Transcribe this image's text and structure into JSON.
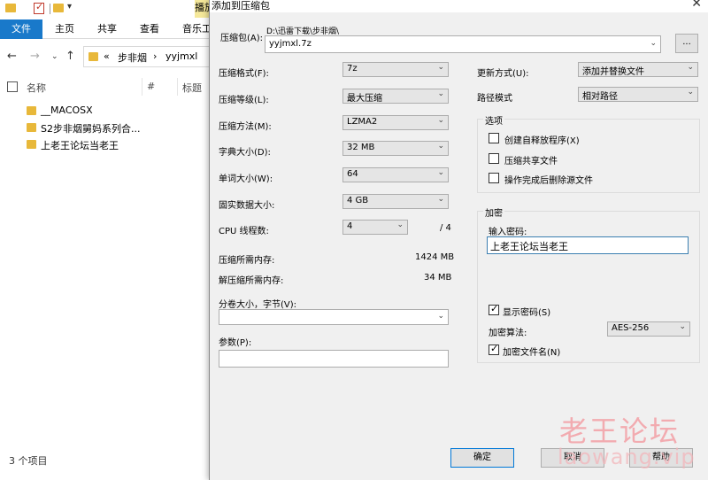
{
  "explorer": {
    "play_tab": "播放",
    "ribbon": {
      "file": "文件",
      "home": "主页",
      "share": "共享",
      "view": "查看",
      "music": "音乐工"
    },
    "breadcrumb": {
      "chevrons": "«",
      "crumb1": "步非烟",
      "sep": "›",
      "crumb2": "yyjmxl"
    },
    "columns": {
      "name": "名称",
      "number": "#",
      "title": "标题"
    },
    "files": [
      "__MACOSX",
      "S2步非烟舅妈系列合...",
      "上老王论坛当老王"
    ],
    "status": "3 个项目"
  },
  "dialog": {
    "title": "添加到压缩包",
    "archive_label": "压缩包(A):",
    "archive_path": "D:\\迅雷下载\\步非烟\\",
    "archive_name": "yyjmxl.7z",
    "browse_label": "...",
    "format_label": "压缩格式(F):",
    "format_value": "7z",
    "level_label": "压缩等级(L):",
    "level_value": "最大压缩",
    "method_label": "压缩方法(M):",
    "method_value": "LZMA2",
    "dict_label": "字典大小(D):",
    "dict_value": "32 MB",
    "word_label": "单词大小(W):",
    "word_value": "64",
    "solid_label": "固实数据大小:",
    "solid_value": "4 GB",
    "cpu_label": "CPU 线程数:",
    "cpu_value": "4",
    "cpu_total": "/ 4",
    "mem_comp_label": "压缩所需内存:",
    "mem_comp_value": "1424 MB",
    "mem_decomp_label": "解压缩所需内存:",
    "mem_decomp_value": "34 MB",
    "split_label": "分卷大小，字节(V):",
    "params_label": "参数(P):",
    "update_label": "更新方式(U):",
    "update_value": "添加并替换文件",
    "path_label": "路径模式",
    "path_value": "相对路径",
    "options_title": "选项",
    "opt_sfx": "创建自释放程序(X)",
    "opt_shared": "压缩共享文件",
    "opt_delete": "操作完成后删除源文件",
    "encrypt_title": "加密",
    "pw_label": "输入密码:",
    "pw_value": "上老王论坛当老王",
    "show_pw": "显示密码(S)",
    "enc_method_label": "加密算法:",
    "enc_method_value": "AES-256",
    "enc_names": "加密文件名(N)",
    "ok": "确定",
    "cancel": "取消",
    "help": "帮助",
    "watermark": "老王论坛",
    "watermark_url": "laowang.vip"
  }
}
